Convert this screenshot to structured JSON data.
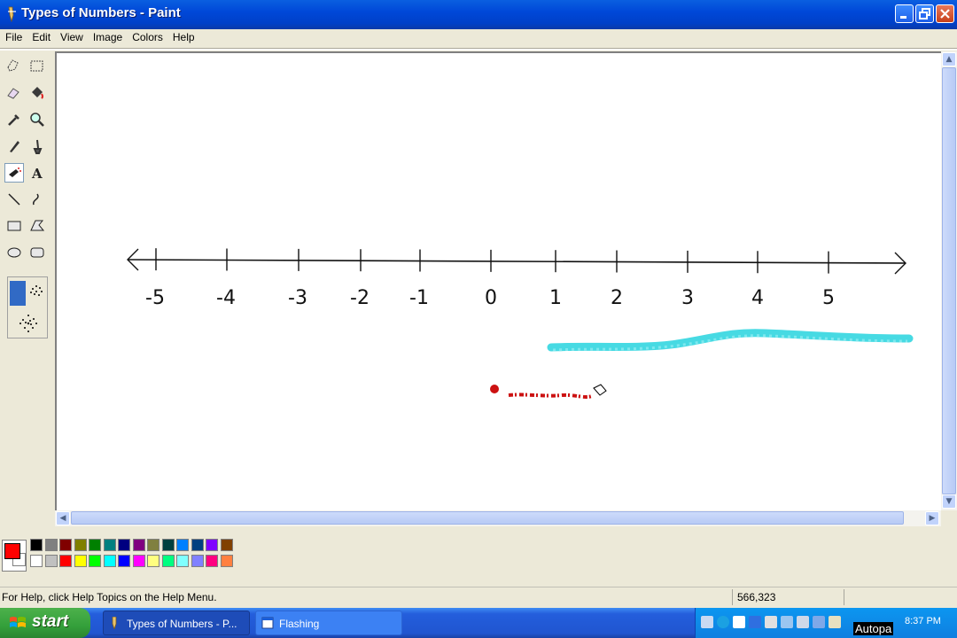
{
  "window": {
    "title": "Types of Numbers - Paint"
  },
  "menu": {
    "items": [
      "File",
      "Edit",
      "View",
      "Image",
      "Colors",
      "Help"
    ]
  },
  "tools": [
    {
      "name": "free-form-select-icon"
    },
    {
      "name": "select-icon"
    },
    {
      "name": "eraser-icon"
    },
    {
      "name": "fill-with-color-icon"
    },
    {
      "name": "pick-color-icon"
    },
    {
      "name": "magnifier-icon"
    },
    {
      "name": "pencil-icon"
    },
    {
      "name": "brush-icon"
    },
    {
      "name": "airbrush-icon"
    },
    {
      "name": "text-icon"
    },
    {
      "name": "line-icon"
    },
    {
      "name": "curve-icon"
    },
    {
      "name": "rectangle-icon"
    },
    {
      "name": "polygon-icon"
    },
    {
      "name": "ellipse-icon"
    },
    {
      "name": "rounded-rectangle-icon"
    }
  ],
  "active_tool": "airbrush-icon",
  "canvas": {
    "number_line": {
      "labels": [
        "-5",
        "-4",
        "-3",
        "-2",
        "-1",
        "0",
        "1",
        "2",
        "3",
        "4",
        "5"
      ]
    },
    "stroke_colors": {
      "cyan": "#33D6E0",
      "red": "#CC1111"
    }
  },
  "palette": {
    "foreground": "#FF0000",
    "background": "#FFFFFF",
    "top_row": [
      "#000000",
      "#808080",
      "#800000",
      "#808000",
      "#008000",
      "#008080",
      "#000080",
      "#800080",
      "#808040",
      "#004040",
      "#0080FF",
      "#004080",
      "#8000FF",
      "#804000"
    ],
    "bottom_row": [
      "#FFFFFF",
      "#C0C0C0",
      "#FF0000",
      "#FFFF00",
      "#00FF00",
      "#00FFFF",
      "#0000FF",
      "#FF00FF",
      "#FFFF80",
      "#00FF80",
      "#80FFFF",
      "#8080FF",
      "#FF0080",
      "#FF8040"
    ]
  },
  "status": {
    "help_text": "For Help, click Help Topics on the Help Menu.",
    "coords": "566,323"
  },
  "taskbar": {
    "start_label": "start",
    "tasks": [
      "Types of Numbers - P...",
      "Flashing"
    ],
    "autopan": "Autopa",
    "clock": "8:37 PM"
  }
}
